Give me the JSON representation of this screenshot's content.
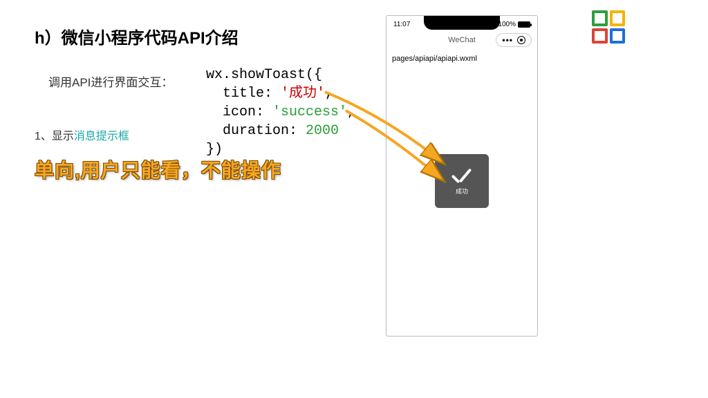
{
  "title": "h）微信小程序代码API介绍",
  "subtitle": "调用API进行界面交互：",
  "list": {
    "prefix": "1、显示",
    "highlight": "消息提示框"
  },
  "code": {
    "l1": "wx.showToast({",
    "l2_key": "  title: ",
    "l2_val": "'成功'",
    "l2_tail": ",",
    "l3_key": "  icon: ",
    "l3_val": "'success'",
    "l3_tail": ",",
    "l4_key": "  duration: ",
    "l4_val": "2000",
    "l5": "})"
  },
  "callout": "单向,用户只能看，不能操作",
  "phone": {
    "time": "11:07",
    "battery_pct": "100%",
    "app_title": "WeChat",
    "page_path": "pages/apiapi/apiapi.wxml",
    "toast_label": "成功"
  }
}
